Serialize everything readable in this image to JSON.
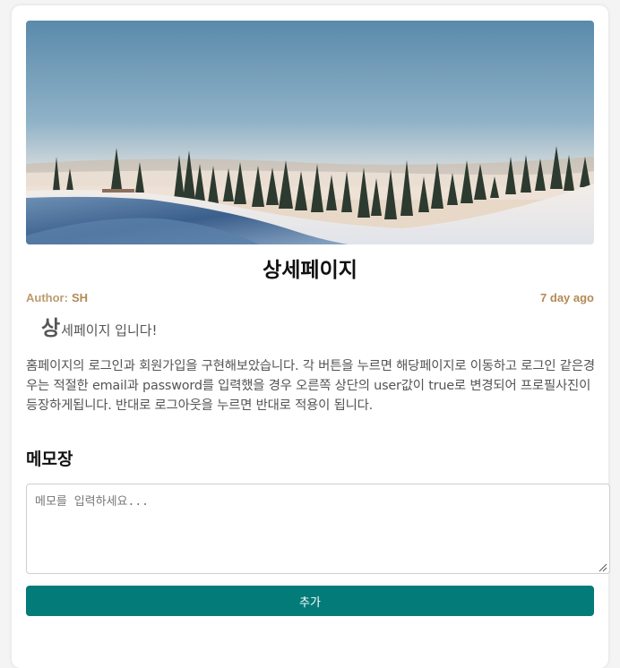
{
  "post": {
    "title": "상세페이지",
    "author_label": "Author:",
    "author_name": "SH",
    "time_ago": "7 day ago",
    "lead_big_char": "상",
    "lead_rest": "세페이지 입니다!",
    "body": "홈페이지의 로그인과 회원가입을 구현해보았습니다. 각 버튼을 누르면 해당페이지로 이동하고 로그인 같은경우는 적절한 email과 password를 입력했을 경우 오른쪽 상단의 user값이 true로 변경되어 프로필사진이 등장하게됩니다. 반대로 로그아웃을 누르면 반대로 적용이 됩니다."
  },
  "memo": {
    "title": "메모장",
    "placeholder": "메모를 입력하세요...",
    "value": "",
    "add_label": "추가"
  },
  "colors": {
    "accent": "#037b79",
    "meta": "#b28a55"
  }
}
